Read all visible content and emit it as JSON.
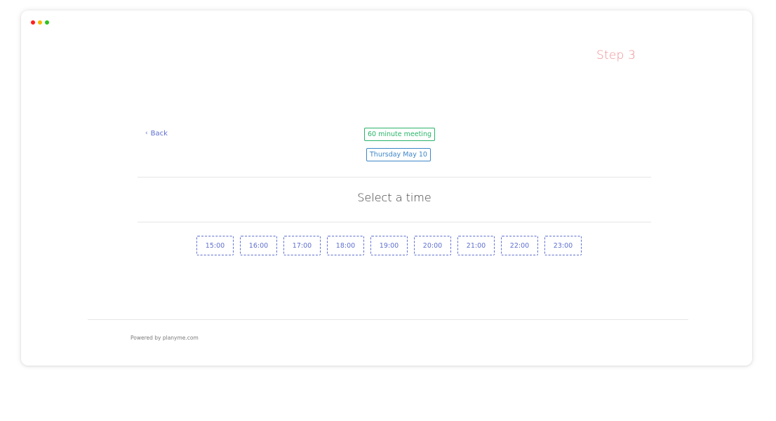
{
  "window": {
    "controls": [
      "close",
      "minimize",
      "maximize"
    ]
  },
  "header": {
    "step_label": "Step 3"
  },
  "navigation": {
    "back_label": "Back",
    "back_icon": "chevron-left-icon"
  },
  "summary": {
    "meeting_type": "60 minute meeting",
    "date": "Thursday May 10"
  },
  "selection": {
    "title": "Select a time",
    "times": [
      "15:00",
      "16:00",
      "17:00",
      "18:00",
      "19:00",
      "20:00",
      "21:00",
      "22:00",
      "23:00"
    ]
  },
  "footer": {
    "powered_by": "Powered by planyme.com"
  },
  "colors": {
    "step": "#ef8f95",
    "link": "#5e6fd0",
    "meeting_badge": "#28b468",
    "date_badge": "#3d86c8"
  }
}
